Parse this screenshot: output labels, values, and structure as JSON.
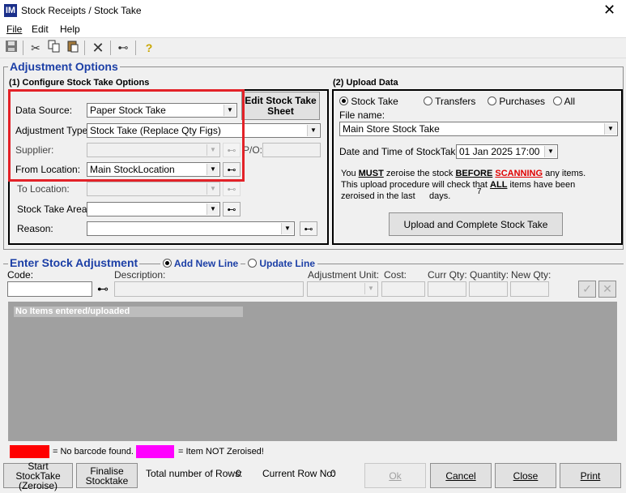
{
  "window": {
    "app_icon": "IM",
    "title": "Stock Receipts / Stock Take",
    "close_glyph": "✕"
  },
  "menu": [
    {
      "label": "File"
    },
    {
      "label": "Edit"
    },
    {
      "label": "Help"
    }
  ],
  "adjustment_options": {
    "title": "Adjustment Options",
    "configure": {
      "heading": "(1) Configure Stock Take Options",
      "edit_sheet_button": "Edit Stock Take Sheet",
      "data_source_label": "Data Source:",
      "data_source_value": "Paper Stock Take",
      "adjustment_type_label": "Adjustment Type:",
      "adjustment_type_value": "Stock Take (Replace Qty Figs)",
      "supplier_label": "Supplier:",
      "supplier_value": "",
      "po_label": "P/O:",
      "from_location_label": "From Location:",
      "from_location_value": "Main StockLocation",
      "to_location_label": "To  Location:",
      "to_location_value": "",
      "stock_take_area_label": "Stock Take Area:",
      "stock_take_area_value": "",
      "reason_label": "Reason:",
      "reason_value": ""
    },
    "upload": {
      "heading": "(2) Upload Data",
      "options": [
        {
          "label": "Stock Take",
          "selected": true
        },
        {
          "label": "Transfers",
          "selected": false
        },
        {
          "label": "Purchases",
          "selected": false
        },
        {
          "label": "All",
          "selected": false
        }
      ],
      "file_name_label": "File name:",
      "file_name_value": "Main Store Stock Take",
      "datetime_label": "Date and Time of StockTake:",
      "datetime_value": "01 Jan 2025 17:00",
      "warning": {
        "you": "You",
        "must": "MUST",
        "zeroise": "zeroise the stock",
        "before": "BEFORE",
        "scanning": "SCANNING",
        "any_items": "any items.",
        "line2a": "This upload procedure will check that",
        "all": "ALL",
        "line2b": "items have been",
        "line3a": "zeroised in the last",
        "days_value": "7",
        "line3b": "days."
      },
      "upload_button": "Upload and Complete Stock Take"
    }
  },
  "enter_adjustment": {
    "title": "Enter Stock Adjustment",
    "mode_options": [
      {
        "label": "Add New Line",
        "selected": true
      },
      {
        "label": "Update Line",
        "selected": false
      }
    ],
    "columns": {
      "code": "Code:",
      "description": "Description:",
      "adjustment_unit": "Adjustment Unit:",
      "cost": "Cost:",
      "curr_qty": "Curr Qty:",
      "quantity": "Quantity:",
      "new_qty": "New Qty:"
    },
    "empty_message": "No Items entered/uploaded",
    "legend": [
      {
        "text": "= No barcode found.",
        "color": "#ff0000"
      },
      {
        "text": "= Item NOT Zeroised!",
        "color": "#ff00ff"
      }
    ]
  },
  "footer": {
    "start_button_line1": "Start StockTake",
    "start_button_line2": "(Zeroise)",
    "finalise_button_line1": "Finalise",
    "finalise_button_line2": "Stocktake",
    "total_rows_label": "Total number of Rows:",
    "total_rows_value": "0",
    "current_row_label": "Current Row No:",
    "current_row_value": "0",
    "ok_button": "Ok",
    "cancel_button": "Cancel",
    "close_button": "Close",
    "print_button": "Print"
  },
  "colors": {
    "accent": "#1c3fa6",
    "highlight": "#e32228",
    "grid_bg": "#a0a0a0"
  }
}
